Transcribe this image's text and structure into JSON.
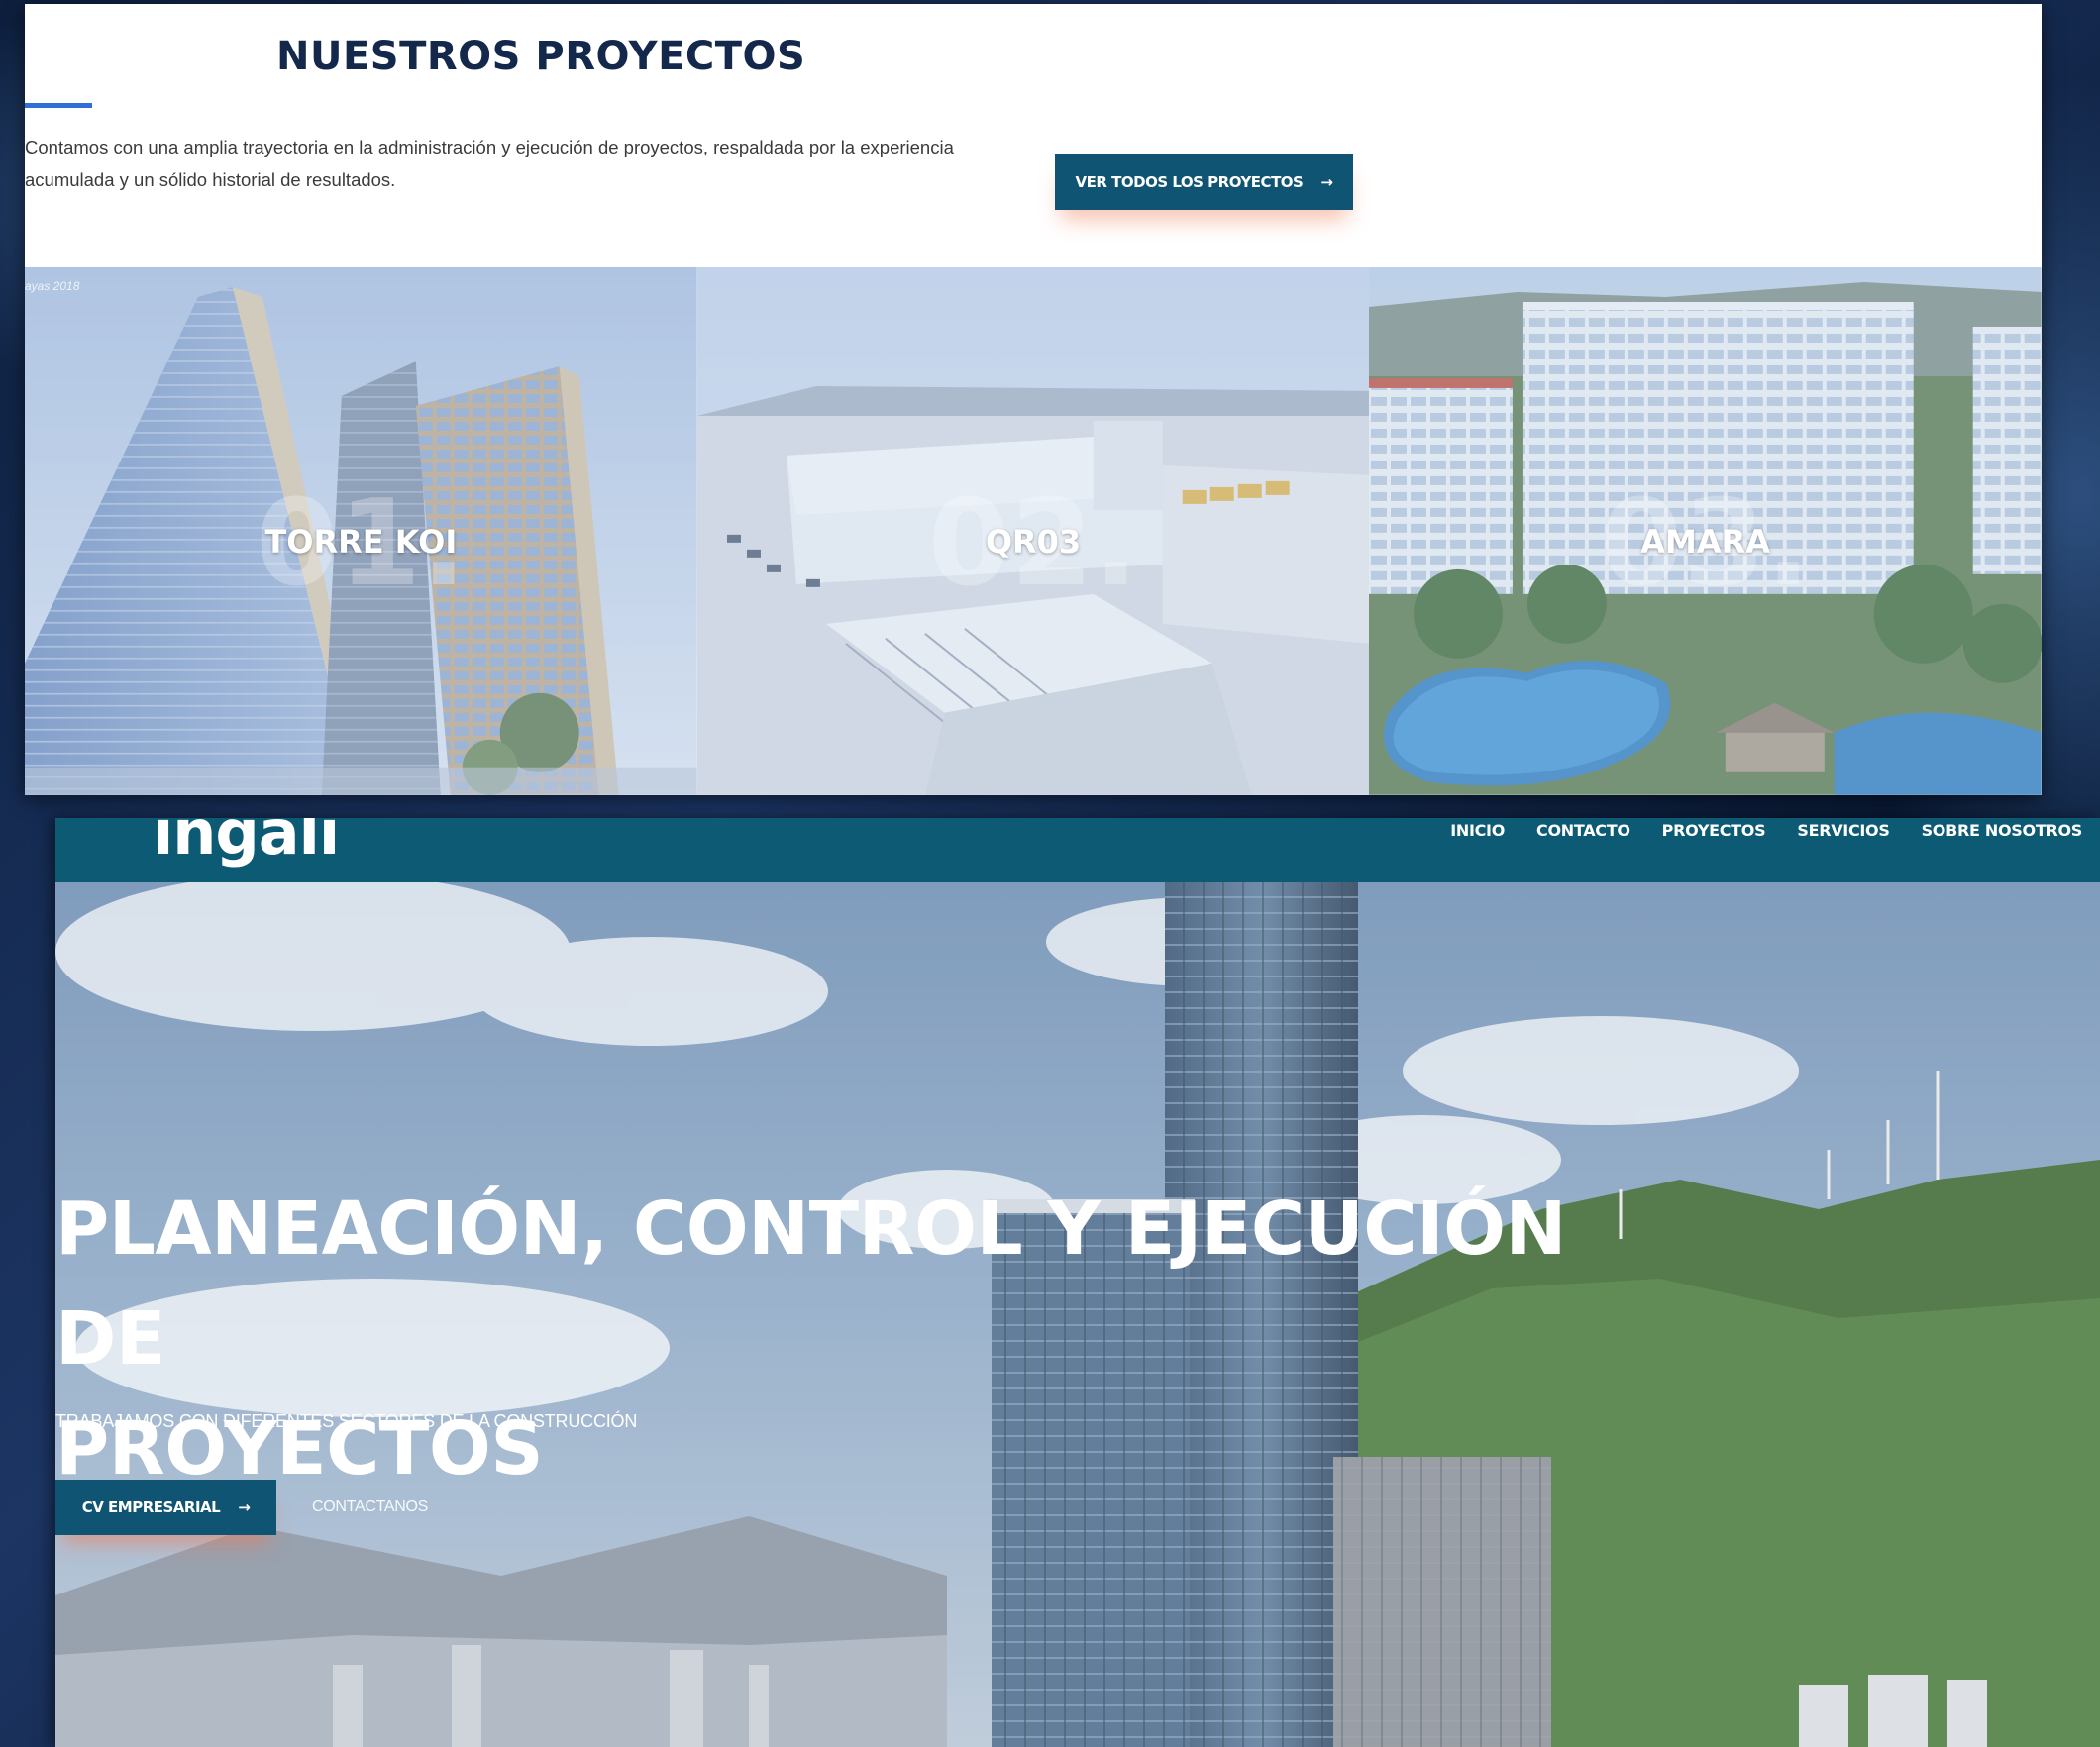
{
  "projects_section": {
    "title": "NUESTROS PROYECTOS",
    "description_line1": "Contamos con una amplia trayectoria en la administración y ejecución de proyectos, respaldada por la experiencia",
    "description_line2": "acumulada y un sólido historial de resultados.",
    "view_all_button": "VER TODOS LOS PROYECTOS",
    "arrow": "→",
    "accent_color": "#2f6fd6",
    "button_color": "#0f5472",
    "watermark": "ayas 2018",
    "cards": [
      {
        "number": "01.",
        "name": "TORRE KOI"
      },
      {
        "number": "02.",
        "name": "QR03"
      },
      {
        "number": "03.",
        "name": "AMARA"
      }
    ]
  },
  "hero_section": {
    "logo": "ingali",
    "nav": [
      "INICIO",
      "CONTACTO",
      "PROYECTOS",
      "SERVICIOS",
      "SOBRE NOSOTROS"
    ],
    "heading_line1": "PLANEACIÓN, CONTROL Y EJECUCIÓN DE",
    "heading_line2": "PROYECTOS",
    "subtitle": "TRABAJAMOS CON DIFERENTES SECTORES DE LA CONSTRUCCIÓN",
    "cv_button": "CV EMPRESARIAL",
    "arrow": "→",
    "contact_link": "CONTACTANOS",
    "navbar_color": "#0d5a74"
  }
}
